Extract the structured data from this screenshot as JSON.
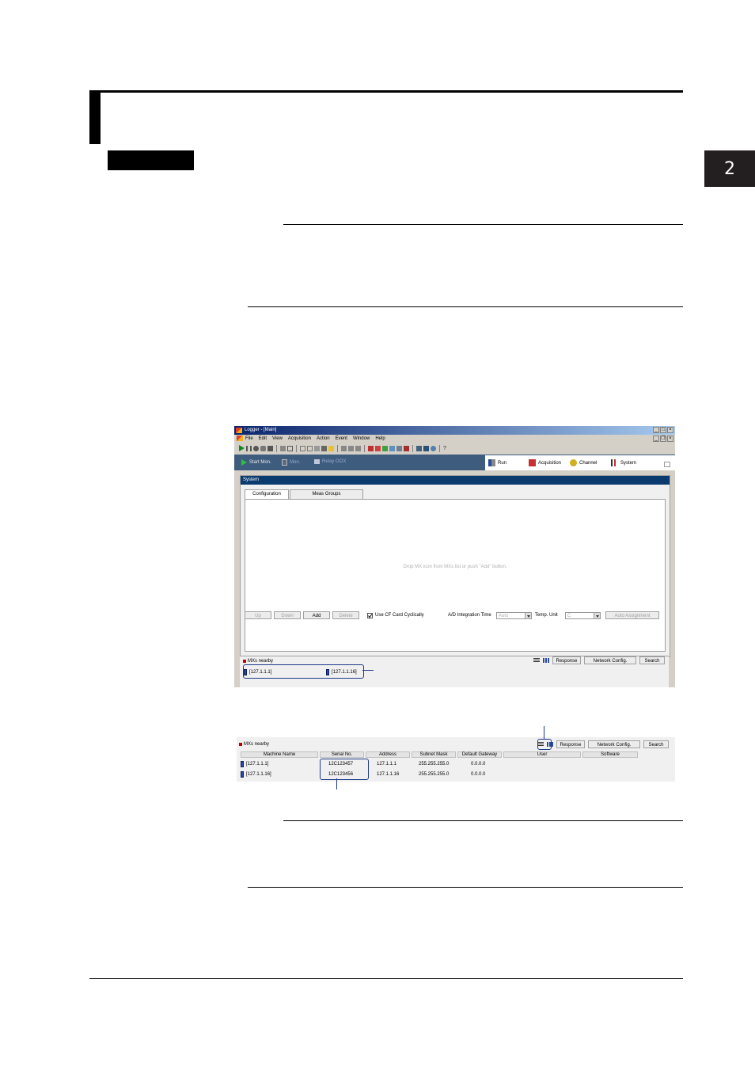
{
  "chapter_tab": "2",
  "screenshot1": {
    "title": "Logger - [Main]",
    "menu": [
      "File",
      "Edit",
      "View",
      "Acquisition",
      "Action",
      "Event",
      "Window",
      "Help"
    ],
    "nav_left": [
      "Start Mon.",
      "Mon.",
      "Relay OOX"
    ],
    "nav_right": [
      "Run",
      "Acquisition",
      "Channel",
      "System"
    ],
    "system_title": "System",
    "tabs": [
      "Configuration",
      "Meas Groups"
    ],
    "drop_hint": "Drop MX icon from MXs list or push \"Add\" button.",
    "buttons": {
      "up": "Up",
      "down": "Down",
      "add": "Add",
      "delete": "Delete",
      "auto": "Auto Assignment"
    },
    "use_cf": "Use CF Card Cyclically",
    "ad_label": "A/D Integration Time",
    "ad_value": "Auto",
    "temp_label": "Temp. Unit",
    "temp_value": "C",
    "mxs_title": "MXs nearby",
    "mx_buttons": [
      "Response",
      "Network Config.",
      "Search"
    ],
    "mx_items": [
      "[127.1.1.1]",
      "[127.1.1.16]"
    ]
  },
  "screenshot2": {
    "mxs_title": "MXs nearby",
    "buttons": [
      "Response",
      "Network Config.",
      "Search"
    ],
    "headers": [
      "Machine Name",
      "Serial No.",
      "Address",
      "Subnet Mask",
      "Default Gateway",
      "User",
      "Software"
    ],
    "rows": [
      [
        "[127.1.1.1]",
        "12C123457",
        "127.1.1.1",
        "255.255.255.0",
        "0.0.0.0"
      ],
      [
        "[127.1.1.16]",
        "12C123456",
        "127.1.1.16",
        "255.255.255.0",
        "0.0.0.0"
      ]
    ]
  }
}
